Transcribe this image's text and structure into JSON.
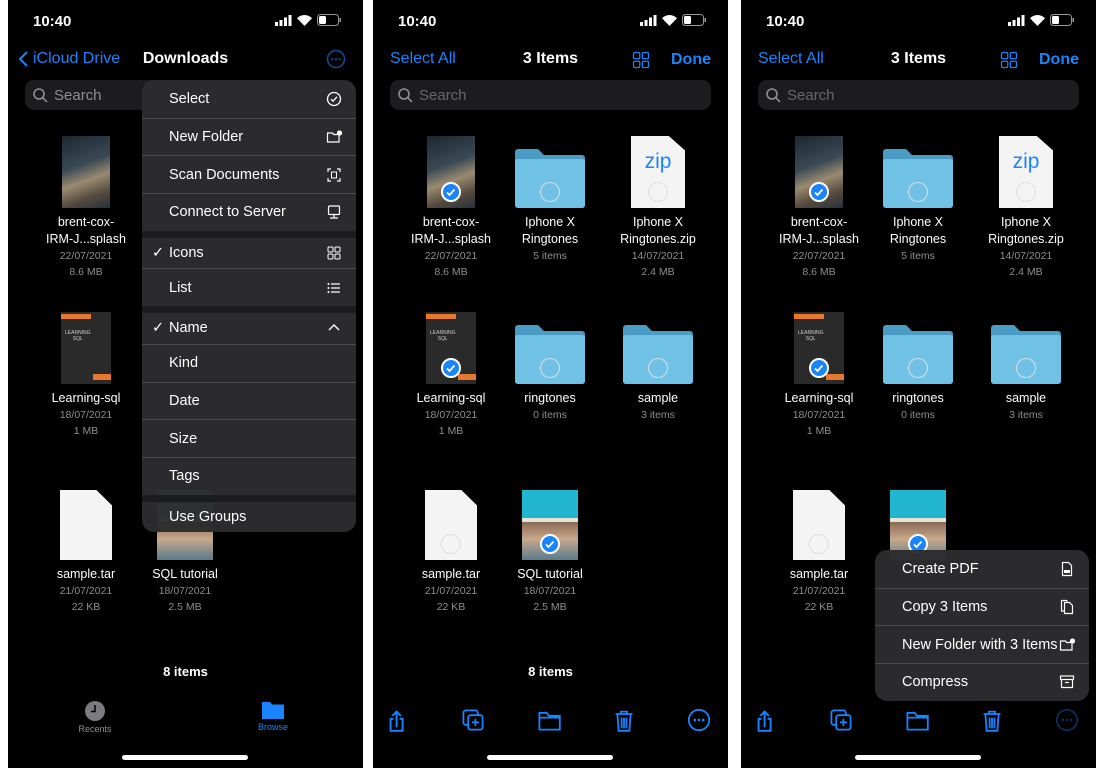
{
  "colors": {
    "accent": "#1a84ff",
    "background": "#000000",
    "menu": "#2c2c2e",
    "folder": "#6fc1e6"
  },
  "panels": [
    {
      "status": {
        "time": "10:40"
      },
      "nav": {
        "back": "iCloud Drive",
        "title": "Downloads",
        "more_icon": "ellipsis-circle-icon"
      },
      "search": {
        "placeholder": "Search"
      },
      "items": [
        {
          "line1": "brent-cox-",
          "line2": "IRM-J...splash",
          "date": "22/07/2021",
          "meta": "8.6 MB",
          "thumb": "photo"
        },
        null,
        null,
        {
          "line1": "Learning-sql",
          "line2": "",
          "date": "18/07/2021",
          "meta": "1 MB",
          "thumb": "book"
        },
        null,
        null,
        {
          "line1": "sample.tar",
          "line2": "",
          "date": "21/07/2021",
          "meta": "22 KB",
          "thumb": "doc"
        },
        {
          "line1": "SQL tutorial",
          "line2": "",
          "date": "18/07/2021",
          "meta": "2.5 MB",
          "thumb": "sqlbook"
        }
      ],
      "footer": "8 items",
      "tabbar": [
        {
          "label": "Recents",
          "icon": "clock-icon",
          "active": false
        },
        {
          "label": "Browse",
          "icon": "folder-icon",
          "active": true
        }
      ],
      "menu": {
        "position": "top",
        "items": [
          {
            "label": "Select",
            "icon": "checkmark-circle-icon"
          },
          {
            "label": "New Folder",
            "icon": "folder-badge-plus-icon"
          },
          {
            "label": "Scan Documents",
            "icon": "doc-viewfinder-icon"
          },
          {
            "label": "Connect to Server",
            "icon": "desktop-computer-icon"
          },
          {
            "label": "Icons",
            "icon": "grid-icon",
            "checked": true,
            "group_start": true
          },
          {
            "label": "List",
            "icon": "list-icon"
          },
          {
            "label": "Name",
            "icon": "chevron-up-icon",
            "checked": true,
            "group_start": true
          },
          {
            "label": "Kind"
          },
          {
            "label": "Date"
          },
          {
            "label": "Size"
          },
          {
            "label": "Tags"
          },
          {
            "label": "Use Groups",
            "group_start": true
          }
        ]
      }
    },
    {
      "status": {
        "time": "10:40"
      },
      "nav": {
        "left": "Select All",
        "title": "3 Items",
        "done": "Done"
      },
      "search": {
        "placeholder": "Search"
      },
      "items": [
        {
          "line1": "brent-cox-",
          "line2": "IRM-J...splash",
          "date": "22/07/2021",
          "meta": "8.6 MB",
          "thumb": "photo",
          "selected": true
        },
        {
          "line1": "Iphone X",
          "line2": "Ringtones",
          "date": "",
          "meta": "5 items",
          "thumb": "folder",
          "selected": false
        },
        {
          "line1": "Iphone X",
          "line2": "Ringtones.zip",
          "date": "14/07/2021",
          "meta": "2.4 MB",
          "thumb": "zip",
          "thumb_text": "zip",
          "selected": false
        },
        {
          "line1": "Learning-sql",
          "line2": "",
          "date": "18/07/2021",
          "meta": "1 MB",
          "thumb": "book",
          "selected": true
        },
        {
          "line1": "ringtones",
          "line2": "",
          "date": "",
          "meta": "0 items",
          "thumb": "folder",
          "selected": false
        },
        {
          "line1": "sample",
          "line2": "",
          "date": "",
          "meta": "3 items",
          "thumb": "folder",
          "selected": false
        },
        {
          "line1": "sample.tar",
          "line2": "",
          "date": "21/07/2021",
          "meta": "22 KB",
          "thumb": "doc",
          "selected": false
        },
        {
          "line1": "SQL tutorial",
          "line2": "",
          "date": "18/07/2021",
          "meta": "2.5 MB",
          "thumb": "sqlbook",
          "selected": true
        }
      ],
      "footer": "8 items",
      "toolbar": [
        "share-icon",
        "duplicate-icon",
        "move-folder-icon",
        "trash-icon",
        "ellipsis-circle-icon"
      ]
    },
    {
      "status": {
        "time": "10:40"
      },
      "nav": {
        "left": "Select All",
        "title": "3 Items",
        "done": "Done"
      },
      "search": {
        "placeholder": "Search"
      },
      "items": [
        {
          "line1": "brent-cox-",
          "line2": "IRM-J...splash",
          "date": "22/07/2021",
          "meta": "8.6 MB",
          "thumb": "photo",
          "selected": true
        },
        {
          "line1": "Iphone X",
          "line2": "Ringtones",
          "date": "",
          "meta": "5 items",
          "thumb": "folder",
          "selected": false
        },
        {
          "line1": "Iphone X",
          "line2": "Ringtones.zip",
          "date": "14/07/2021",
          "meta": "2.4 MB",
          "thumb": "zip",
          "thumb_text": "zip",
          "selected": false
        },
        {
          "line1": "Learning-sql",
          "line2": "",
          "date": "18/07/2021",
          "meta": "1 MB",
          "thumb": "book",
          "selected": true
        },
        {
          "line1": "ringtones",
          "line2": "",
          "date": "",
          "meta": "0 items",
          "thumb": "folder",
          "selected": false
        },
        {
          "line1": "sample",
          "line2": "",
          "date": "",
          "meta": "3 items",
          "thumb": "folder",
          "selected": false
        },
        {
          "line1": "sample.tar",
          "line2": "",
          "date": "21/07/2021",
          "meta": "22 KB",
          "thumb": "doc",
          "selected": false
        },
        {
          "line1": "",
          "line2": "",
          "date": "",
          "meta": "",
          "thumb": "sqlbook",
          "selected": true
        }
      ],
      "toolbar": [
        "share-icon",
        "duplicate-icon",
        "move-folder-icon",
        "trash-icon",
        "ellipsis-circle-icon"
      ],
      "menu": {
        "position": "bottom",
        "items": [
          {
            "label": "Create PDF",
            "icon": "pdf-doc-icon"
          },
          {
            "label": "Copy 3 Items",
            "icon": "copy-doc-icon"
          },
          {
            "label": "New Folder with 3 Items",
            "icon": "folder-badge-plus-icon"
          },
          {
            "label": "Compress",
            "icon": "archive-box-icon"
          }
        ]
      }
    }
  ]
}
